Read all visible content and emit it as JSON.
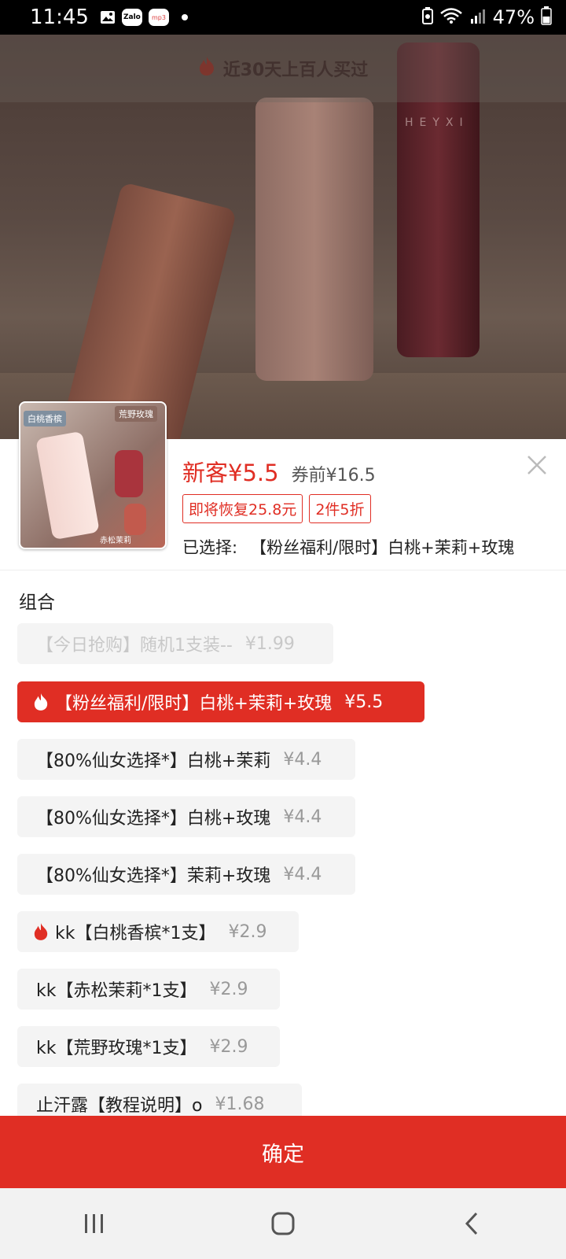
{
  "status_bar": {
    "time": "11:45",
    "battery": "47%"
  },
  "hero": {
    "sold_text": "近30天上百人买过"
  },
  "product": {
    "thumb_tags": [
      "白桃香槟",
      "荒野玫瑰",
      "赤松茉莉"
    ],
    "new_price": "新客¥5.5",
    "old_price": "券前¥16.5",
    "tags": [
      "即将恢复25.8元",
      "2件5折"
    ],
    "selected_label": "已选择:",
    "selected_value": "【粉丝福利/限时】白桃+茉莉+玫瑰"
  },
  "group": {
    "title": "组合",
    "options": [
      {
        "label": "【今日抢购】随机1支装--",
        "price": "¥1.99",
        "state": "disabled"
      },
      {
        "label": "【粉丝福利/限时】白桃+茉莉+玫瑰",
        "price": "¥5.5",
        "state": "selected"
      },
      {
        "label": "【80%仙女选择*】白桃+茉莉",
        "price": "¥4.4",
        "state": "normal"
      },
      {
        "label": "【80%仙女选择*】白桃+玫瑰",
        "price": "¥4.4",
        "state": "normal"
      },
      {
        "label": "【80%仙女选择*】茉莉+玫瑰",
        "price": "¥4.4",
        "state": "normal"
      },
      {
        "label": "kk【白桃香槟*1支】",
        "price": "¥2.9",
        "state": "hot"
      },
      {
        "label": "kk【赤松茉莉*1支】",
        "price": "¥2.9",
        "state": "normal"
      },
      {
        "label": "kk【荒野玫瑰*1支】",
        "price": "¥2.9",
        "state": "normal"
      },
      {
        "label": "止汗露【教程说明】o",
        "price": "¥1.68",
        "state": "normal"
      }
    ]
  },
  "confirm_label": "确定",
  "colors": {
    "accent": "#e02e24"
  }
}
